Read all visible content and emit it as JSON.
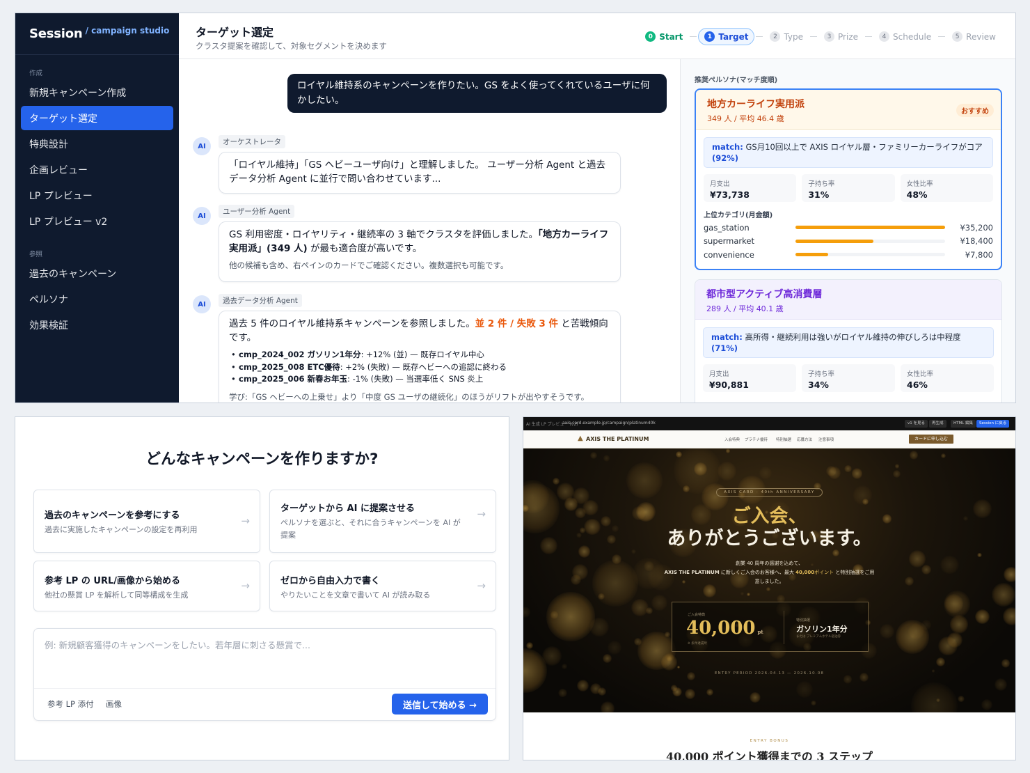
{
  "studio": {
    "brand": "Session",
    "brand_sub": "/ campaign studio",
    "sidebar": {
      "section_create": "作成",
      "items_create": [
        "新規キャンペーン作成",
        "ターゲット選定",
        "特典設計",
        "企画レビュー",
        "LP プレビュー",
        "LP プレビュー v2"
      ],
      "active_index": 1,
      "section_ref": "参照",
      "items_ref": [
        "過去のキャンペーン",
        "ペルソナ",
        "効果検証"
      ]
    },
    "header": {
      "title": "ターゲット選定",
      "subtitle": "クラスタ提案を確認して、対象セグメントを決めます"
    },
    "steps": [
      {
        "num": "0",
        "label": "Start",
        "state": "done"
      },
      {
        "num": "1",
        "label": "Target",
        "state": "current"
      },
      {
        "num": "2",
        "label": "Type",
        "state": "todo"
      },
      {
        "num": "3",
        "label": "Prize",
        "state": "todo"
      },
      {
        "num": "4",
        "label": "Schedule",
        "state": "todo"
      },
      {
        "num": "5",
        "label": "Review",
        "state": "todo"
      }
    ],
    "chat": {
      "user_message": "ロイヤル維持系のキャンペーンを作りたい。GS をよく使ってくれているユーザに何かしたい。",
      "avatar": "AI",
      "m1": {
        "agent": "オーケストレータ",
        "text": "「ロイヤル維持」「GS ヘビーユーザ向け」と理解しました。 ユーザー分析 Agent と過去データ分析 Agent に並行で問い合わせています..."
      },
      "m2": {
        "agent": "ユーザー分析 Agent",
        "text_a": "GS 利用密度・ロイヤリティ・継続率の 3 軸でクラスタを評価しました。",
        "text_b": "「地方カーライフ実用派」(349 人)",
        "text_c": " が最も適合度が高いです。",
        "sub": "他の候補も含め、右ペインのカードでご確認ください。複数選択も可能です。"
      },
      "m3": {
        "agent": "過去データ分析 Agent",
        "text_a": "過去 5 件のロイヤル維持系キャンペーンを参照しました。",
        "text_b": "並 2 件 / 失敗 3 件",
        "text_c": " と苦戦傾向です。",
        "items": [
          {
            "id": "cmp_2024_002 ガソリン1年分",
            "rest": ": +12% (並) — 既存ロイヤル中心"
          },
          {
            "id": "cmp_2025_008 ETC優待",
            "rest": ": +2% (失敗) — 既存ヘビーへの追認に終わる"
          },
          {
            "id": "cmp_2025_006 新春お年玉",
            "rest": ": -1% (失敗) — 当選率低く SNS 炎上"
          }
        ],
        "learning": "学び:「GS ヘビーへの上乗せ」より「中度 GS ユーザの継続化」のほうがリフトが出やすそうです。"
      }
    },
    "personas_label": "推奨ペルソナ(マッチ度順)",
    "personas": [
      {
        "name": "地方カーライフ実用派",
        "stats": "349 人 / 平均 46.4 歳",
        "badge": "おすすめ",
        "match_key": "match:",
        "match_text": "GS月10回以上で AXIS ロイヤル層・ファミリーカーライフがコア",
        "match_pct": "(92%)",
        "k1": "月支出",
        "v1": "¥73,738",
        "k2": "子持ち率",
        "v2": "31%",
        "k3": "女性比率",
        "v3": "48%",
        "cat_label": "上位カテゴリ(月金額)",
        "cats": [
          {
            "name": "gas_station",
            "value": "¥35,200",
            "ratio": 1.0
          },
          {
            "name": "supermarket",
            "value": "¥18,400",
            "ratio": 0.52
          },
          {
            "name": "convenience",
            "value": "¥7,800",
            "ratio": 0.22
          }
        ],
        "accent": "#c2410c",
        "head_bg": "#fff8ea"
      },
      {
        "name": "都市型アクティブ高消費層",
        "stats": "289 人 / 平均 40.1 歳",
        "match_key": "match:",
        "match_text": "高所得・継続利用は強いがロイヤル維持の伸びしろは中程度",
        "match_pct": "(71%)",
        "k1": "月支出",
        "v1": "¥90,881",
        "k2": "子持ち率",
        "v2": "34%",
        "k3": "女性比率",
        "v3": "46%",
        "accent": "#6d28d9",
        "head_bg": "#f3f1fd"
      }
    ]
  },
  "start": {
    "question": "どんなキャンペーンを作りますか?",
    "options": [
      {
        "title": "過去のキャンペーンを参考にする",
        "desc": "過去に実施したキャンペーンの設定を再利用"
      },
      {
        "title": "ターゲットから AI に提案させる",
        "desc": "ペルソナを選ぶと、それに合うキャンペーンを AI が提案"
      },
      {
        "title": "参考 LP の URL/画像から始める",
        "desc": "他社の懸賞 LP を解析して同等構成を生成"
      },
      {
        "title": "ゼロから自由入力で書く",
        "desc": "やりたいことを文章で書いて AI が読み取る"
      }
    ],
    "arrow": "→",
    "placeholder": "例: 新規顧客獲得のキャンペーンをしたい。若年層に刺さる懸賞で...",
    "attach_lp": "参考 LP 添付",
    "attach_image": "画像",
    "send": "送信して始める →"
  },
  "preview": {
    "toolbar_label": "AI 生成 LP プレビュー (v2)",
    "url": "axis-card.example.jp/campaign/platinum40k",
    "toolbar_buttons": [
      "v1 を見る",
      "再生成",
      "HTML 編集",
      "Session に戻る"
    ],
    "logo": "AXIS THE PLATINUM",
    "nav": [
      "入会特典",
      "プラチナ優待",
      "特別抽選",
      "応募方法",
      "注意事項"
    ],
    "cta": "カードに申し込む",
    "eyebrow": "AXIS CARD · 40th ANNIVERSARY",
    "headline_1": "ご入会、",
    "headline_2": "ありがとうございます。",
    "lead_1": "創業 40 周年の感謝を込めて、",
    "lead_2a": "AXIS THE PLATINUM",
    "lead_2b": " に新しくご入会のお客様へ、最大 ",
    "lead_2c": "40,000",
    "lead_2d": "ポイント",
    "lead_2e": " と特別抽選をご用",
    "lead_3": "意しました。",
    "prize_small": "ご入会特典",
    "points": "40,000",
    "points_unit": "pt",
    "points_note": "※ 条件達成時",
    "lottery_small": "特別抽選",
    "lottery": "ガソリン1年分",
    "lottery_note": "または プレミアムホテル宿泊券",
    "period": "ENTRY PERIOD   2026.04.13 — 2026.10.08",
    "bonus_label": "ENTRY BONUS",
    "steps_title": "40,000 ポイント獲得までの 3 ステップ"
  },
  "colors": {
    "primary": "#2563eb",
    "sidebar": "#0f1a2e",
    "gold": "#e3bd5a",
    "orange": "#ea580c"
  }
}
